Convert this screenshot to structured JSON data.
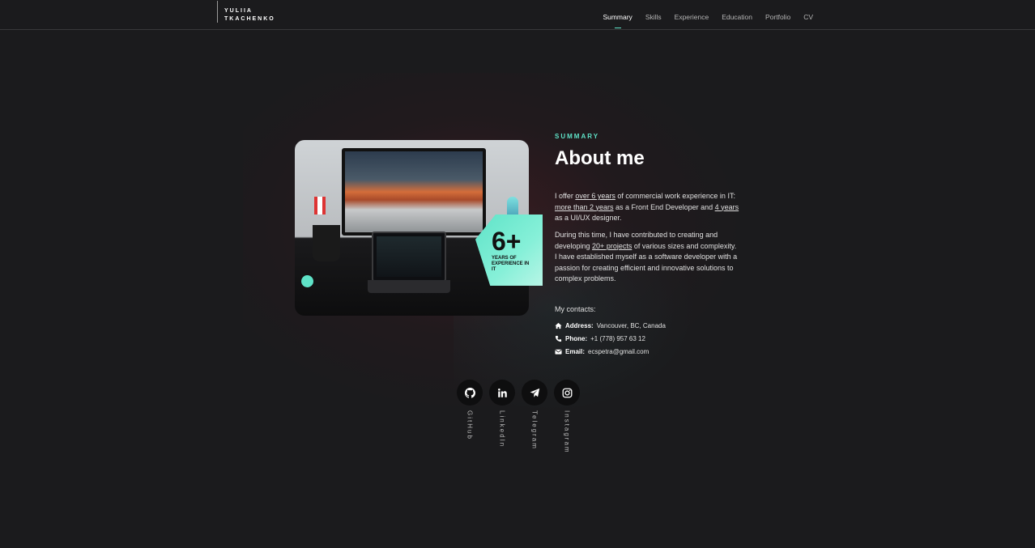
{
  "brand": {
    "line1": "YULIIA",
    "line2": "TKACHENKO"
  },
  "nav": [
    "Summary",
    "Skills",
    "Experience",
    "Education",
    "Portfolio",
    "CV"
  ],
  "badge": {
    "number": "6+",
    "text": "YEARS OF EXPERIENCE IN IT"
  },
  "section_label": "SUMMARY",
  "title": "About me",
  "para1": {
    "t1": "I offer ",
    "l1": "over 6 years",
    "t2": " of commercial work experience in IT: ",
    "l2": "more than 2 years",
    "t3": " as a Front End Developer and ",
    "l3": "4 years",
    "t4": " as a UI/UX designer."
  },
  "para2": {
    "t1": "During this time, I have contributed to creating and developing ",
    "l1": "20+ projects",
    "t2": " of various sizes and complexity. I have established myself as a software developer with a passion for creating efficient and innovative solutions to complex problems."
  },
  "contacts": {
    "title": "My contacts:",
    "address_label": "Address:",
    "address": "Vancouver, BC, Canada",
    "phone_label": "Phone:",
    "phone": "+1 (778) 957 63 12",
    "email_label": "Email:",
    "email": "ecspetra@gmail.com"
  },
  "socials": [
    "GitHub",
    "LinkedIn",
    "Telegram",
    "Instagram"
  ],
  "colors": {
    "accent": "#5fe3c8",
    "background": "#1b1b1d"
  }
}
